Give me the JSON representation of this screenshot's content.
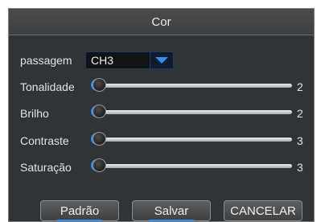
{
  "dialog": {
    "title": "Cor"
  },
  "channel": {
    "label": "passagem",
    "value": "CH3"
  },
  "sliders": [
    {
      "label": "Tonalidade",
      "value": "2",
      "level": 0.0
    },
    {
      "label": "Brilho",
      "value": "2",
      "level": 0.0
    },
    {
      "label": "Contraste",
      "value": "3",
      "level": 0.0
    },
    {
      "label": "Saturação",
      "value": "3",
      "level": 0.0
    }
  ],
  "buttons": {
    "default_label": "Padrão",
    "save_label": "Salvar",
    "cancel_label": "CANCELAR"
  },
  "colors": {
    "accent": "#2f8ef2",
    "panel": "#313436",
    "titlebar": "#434547"
  }
}
